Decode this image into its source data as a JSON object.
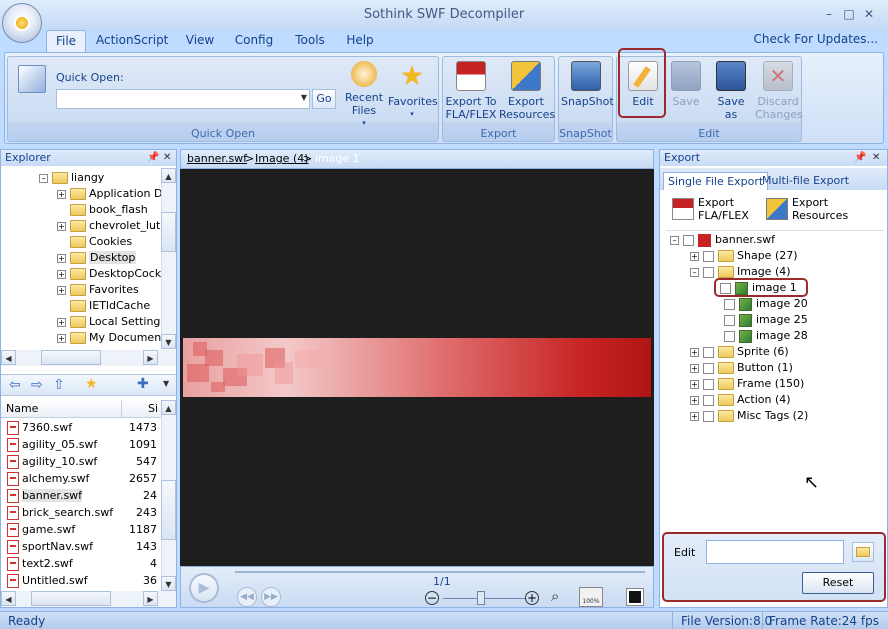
{
  "window": {
    "title": "Sothink SWF Decompiler"
  },
  "menu_tabs": [
    "File",
    "ActionScript",
    "View",
    "Config",
    "Tools",
    "Help"
  ],
  "check_updates": "Check For Updates...",
  "ribbon": {
    "quick_open_label": "Quick Open:",
    "go_label": "Go",
    "recent_files": "Recent Files",
    "favorites": "Favorites",
    "export_fla": "Export To FLA/FLEX",
    "export_res": "Export Resources",
    "snapshot": "SnapShot",
    "edit": "Edit",
    "save": "Save",
    "save_as": "Save as",
    "discard": "Discard Changes",
    "group_quick_open": "Quick Open",
    "group_export": "Export",
    "group_snapshot": "SnapShot",
    "group_edit": "Edit"
  },
  "explorer": {
    "title": "Explorer",
    "tree": [
      "liangy",
      "Application Da",
      "book_flash",
      "chevrolet_lut",
      "Cookies",
      "Desktop",
      "DesktopCockp",
      "Favorites",
      "IETldCache",
      "Local Settings",
      "My Documen"
    ],
    "col_name": "Name",
    "col_size": "Si",
    "files": [
      {
        "name": "7360.swf",
        "size": "1473"
      },
      {
        "name": "agility_05.swf",
        "size": "1091"
      },
      {
        "name": "agility_10.swf",
        "size": "547"
      },
      {
        "name": "alchemy.swf",
        "size": "2657"
      },
      {
        "name": "banner.swf",
        "size": "24"
      },
      {
        "name": "brick_search.swf",
        "size": "243"
      },
      {
        "name": "game.swf",
        "size": "1187"
      },
      {
        "name": "sportNav.swf",
        "size": "143"
      },
      {
        "name": "text2.swf",
        "size": "4"
      },
      {
        "name": "Untitled.swf",
        "size": "36"
      }
    ]
  },
  "breadcrumb": {
    "a": "banner.swf",
    "sep": ">",
    "b": "Image (4)",
    "c": "image 1"
  },
  "player": {
    "frame": "1/1"
  },
  "export": {
    "title": "Export",
    "tab_single": "Single File Export",
    "tab_multi": "Multi-file Export",
    "btn_fla": "Export FLA/FLEX",
    "btn_res": "Export Resources",
    "root": "banner.swf",
    "nodes": [
      "Shape (27)",
      "Image (4)",
      "image 1",
      "image 20",
      "image 25",
      "image 28",
      "Sprite (6)",
      "Button (1)",
      "Frame (150)",
      "Action (4)",
      "Misc Tags (2)"
    ],
    "edit_label": "Edit",
    "edit_value": "",
    "reset_label": "Reset"
  },
  "status": {
    "left": "Ready",
    "version": "File Version:8.0",
    "fps": "Frame Rate:24 fps"
  }
}
